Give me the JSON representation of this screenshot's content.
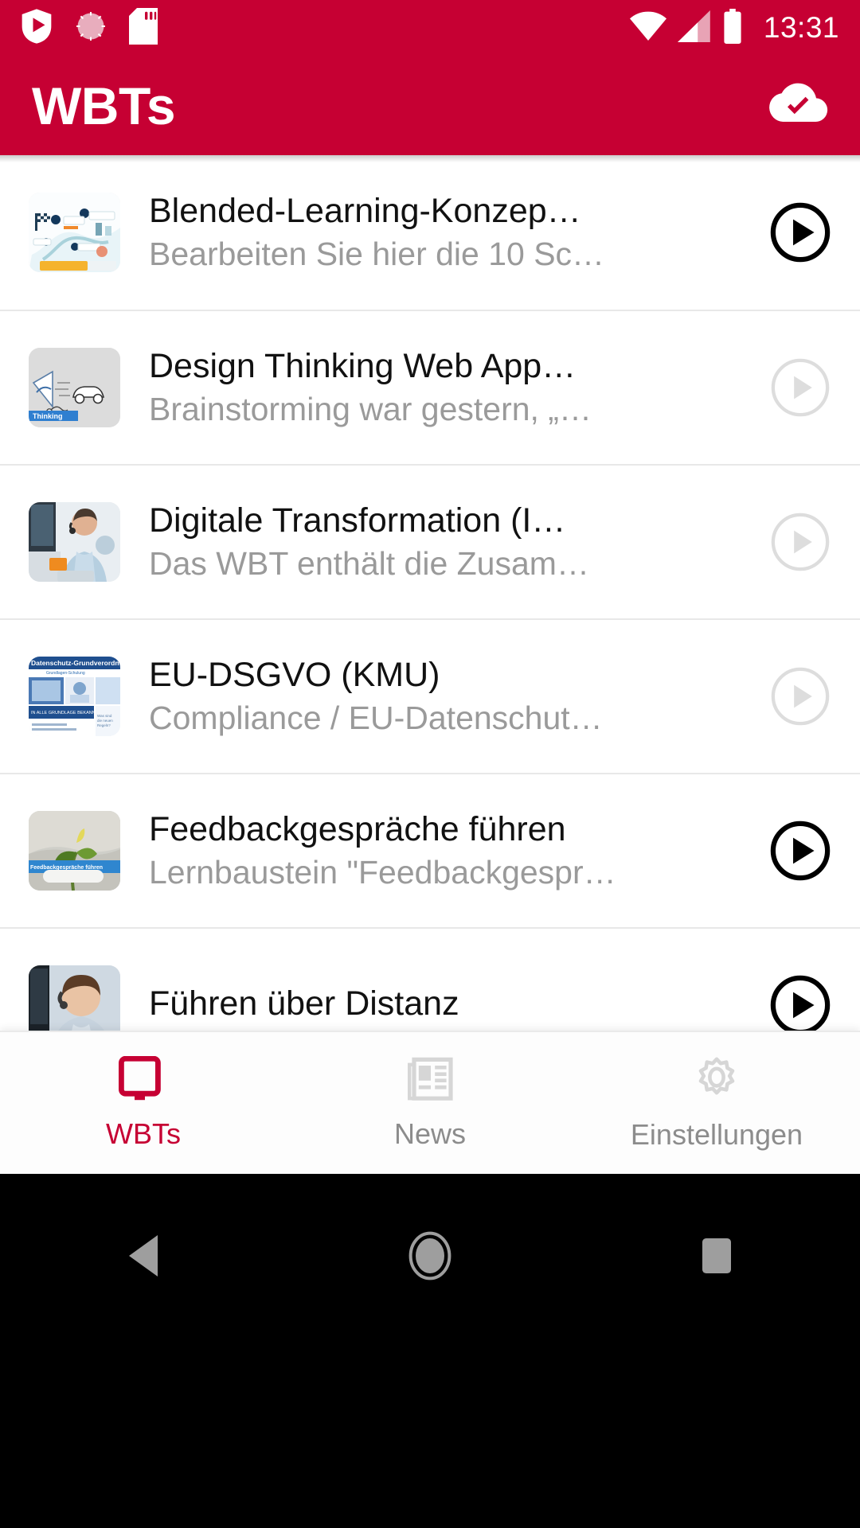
{
  "statusbar": {
    "time": "13:31",
    "left_icons": [
      "play-protect-shield-icon",
      "sync-spinner-icon",
      "sd-card-icon"
    ],
    "right_icons": [
      "wifi-icon",
      "cellular-signal-icon",
      "battery-full-icon"
    ],
    "background_color": "#C60033"
  },
  "appbar": {
    "title": "WBTs",
    "action_icon": "cloud-check-icon",
    "background_color": "#C60033",
    "text_color": "#FFFFFF"
  },
  "list": {
    "items": [
      {
        "title": "Blended-Learning-Konzep…",
        "subtitle": "Bearbeiten Sie hier die 10 Sc…",
        "thumbnail": "blended-learning-roadmap-thumbnail",
        "play_state": "enabled",
        "play_icon": "play-circle-icon"
      },
      {
        "title": "Design Thinking Web App…",
        "subtitle": "Brainstorming war gestern, „…",
        "thumbnail": "design-thinking-car-sketch-thumbnail",
        "play_state": "disabled",
        "play_icon": "play-circle-icon"
      },
      {
        "title": "Digitale Transformation (I…",
        "subtitle": "Das WBT enthält die Zusam…",
        "thumbnail": "digitale-transformation-callcenter-thumbnail",
        "play_state": "disabled",
        "play_icon": "play-circle-icon"
      },
      {
        "title": "EU-DSGVO (KMU)",
        "subtitle": "Compliance / EU-Datenschut…",
        "thumbnail": "eu-dsgvo-datenschutz-thumbnail",
        "play_state": "disabled",
        "play_icon": "play-circle-icon"
      },
      {
        "title": "Feedbackgespräche führen",
        "subtitle": "Lernbaustein \"Feedbackgespr…",
        "thumbnail": "feedbackgespraeche-plant-thumbnail",
        "play_state": "enabled",
        "play_icon": "play-circle-icon"
      },
      {
        "title": "Führen über Distanz",
        "subtitle": "",
        "thumbnail": "fuehren-ueber-distanz-headset-thumbnail",
        "play_state": "enabled",
        "play_icon": "play-circle-icon"
      }
    ]
  },
  "bottomnav": {
    "active_color": "#C60033",
    "inactive_color": "#8C8C8C",
    "items": [
      {
        "label": "WBTs",
        "icon": "monitor-icon",
        "active": true
      },
      {
        "label": "News",
        "icon": "newspaper-icon",
        "active": false
      },
      {
        "label": "Einstellungen",
        "icon": "gear-icon",
        "active": false
      }
    ]
  },
  "androidnav": {
    "buttons": [
      {
        "name": "back-button",
        "icon": "back-triangle-icon"
      },
      {
        "name": "home-button",
        "icon": "home-circle-icon"
      },
      {
        "name": "recents-button",
        "icon": "recents-square-icon"
      }
    ]
  }
}
